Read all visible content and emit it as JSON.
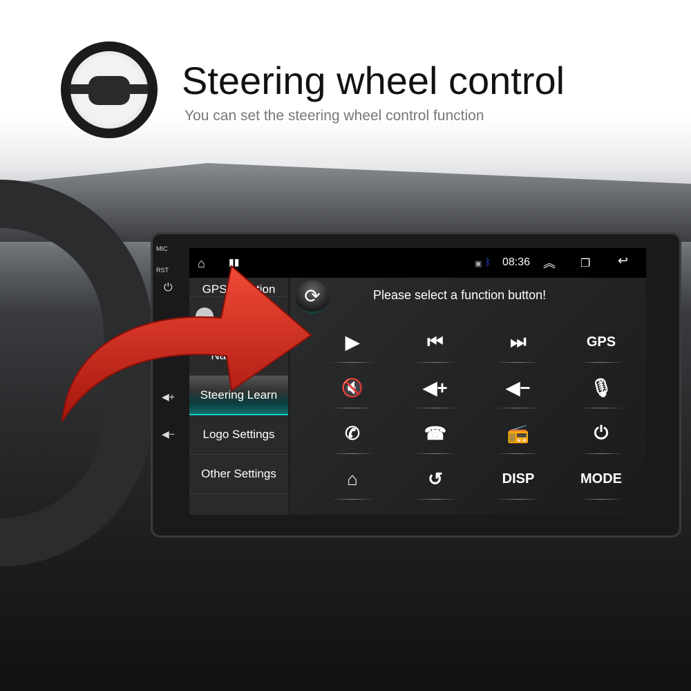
{
  "header": {
    "title": "Steering wheel control",
    "subtitle": "You can set the steering wheel control function"
  },
  "bezel": {
    "mic": "MIC",
    "rst": "RST"
  },
  "status": {
    "time": "08:36",
    "icons": [
      "home-icon",
      "recent-apps-icon",
      "cast-icon",
      "bluetooth-icon",
      "chevron-up-icon",
      "window-icon",
      "back-icon"
    ]
  },
  "menu": {
    "items": [
      {
        "label": "GPS Function"
      },
      {
        "label": ""
      },
      {
        "label": "Navigation"
      },
      {
        "label": "Steering Learn",
        "active": true
      },
      {
        "label": "Logo Settings"
      },
      {
        "label": "Other Settings"
      }
    ]
  },
  "panel": {
    "prompt": "Please select a function button!",
    "buttons": [
      {
        "name": "play",
        "glyph": "▶"
      },
      {
        "name": "previous",
        "glyph": "⏮"
      },
      {
        "name": "next",
        "glyph": "⏭"
      },
      {
        "name": "gps",
        "glyph": "GPS"
      },
      {
        "name": "mute",
        "glyph": "🔇"
      },
      {
        "name": "volume-up",
        "glyph": "◀+"
      },
      {
        "name": "volume-down",
        "glyph": "◀−"
      },
      {
        "name": "microphone",
        "glyph": "🎙"
      },
      {
        "name": "phone-answer",
        "glyph": "✆"
      },
      {
        "name": "phone-hangup",
        "glyph": "☎"
      },
      {
        "name": "radio",
        "glyph": "📻"
      },
      {
        "name": "power",
        "glyph": "⏻"
      },
      {
        "name": "home",
        "glyph": "⌂"
      },
      {
        "name": "back",
        "glyph": "↺"
      },
      {
        "name": "disp",
        "glyph": "DISP"
      },
      {
        "name": "mode",
        "glyph": "MODE"
      }
    ]
  },
  "colors": {
    "accent": "#1cc4c4",
    "arrow": "#d92b1e"
  }
}
